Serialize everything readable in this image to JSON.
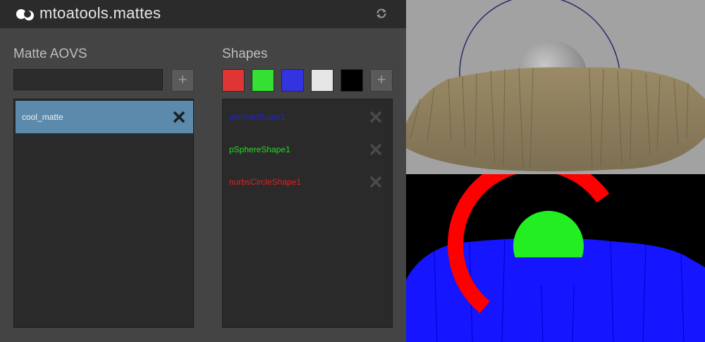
{
  "app": {
    "title": "mtoatools.mattes"
  },
  "aovs": {
    "heading": "Matte AOVS",
    "input_value": "",
    "add_label": "+",
    "items": [
      {
        "label": "cool_matte",
        "selected": true
      }
    ]
  },
  "shapes": {
    "heading": "Shapes",
    "add_label": "+",
    "swatches": [
      {
        "name": "red",
        "color": "#e03535"
      },
      {
        "name": "green",
        "color": "#33e033"
      },
      {
        "name": "blue",
        "color": "#3333e0"
      },
      {
        "name": "white",
        "color": "#e6e6e6"
      },
      {
        "name": "black",
        "color": "#000000"
      }
    ],
    "items": [
      {
        "label": "pfxHairShape1",
        "color": "#2222dd"
      },
      {
        "label": "pSphereShape1",
        "color": "#22dd22"
      },
      {
        "label": "nurbsCircleShape1",
        "color": "#dd2222"
      }
    ]
  },
  "icons": {
    "logo": "mtoa-logo-icon",
    "refresh": "refresh-icon",
    "remove": "close-x-icon"
  },
  "colors": {
    "selection": "#5b8aad",
    "panel_bg": "#444444",
    "titlebar_bg": "#2b2b2b"
  }
}
